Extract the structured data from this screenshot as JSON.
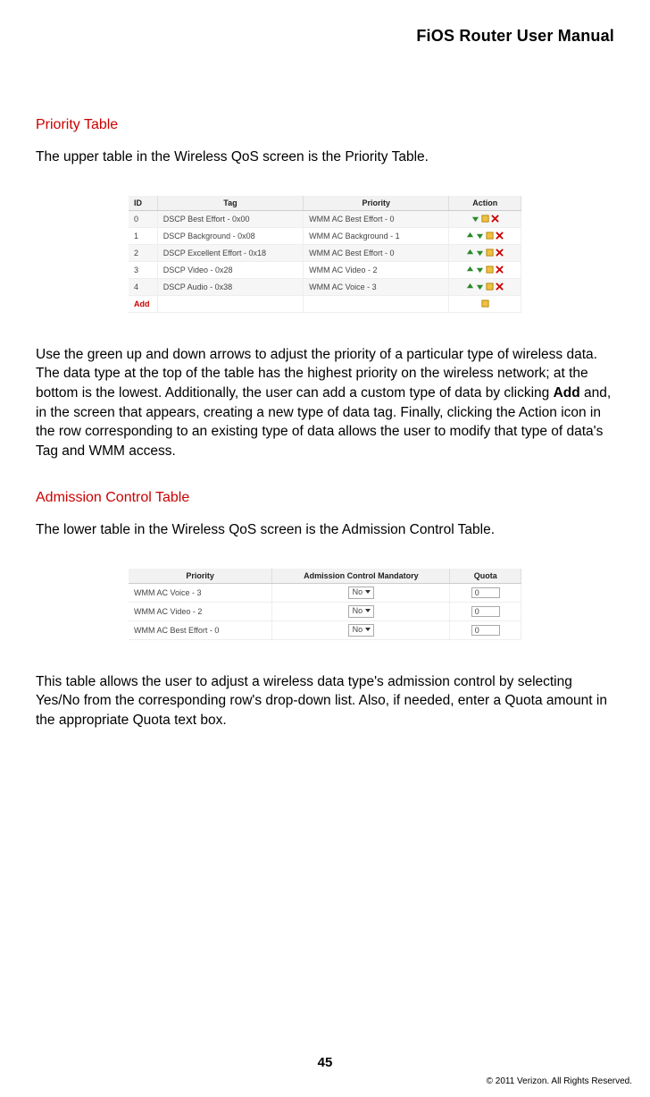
{
  "header": {
    "title": "FiOS Router User Manual"
  },
  "section1": {
    "heading": "Priority Table",
    "intro": "The upper table in the Wireless QoS screen is the Priority Table."
  },
  "priority_table": {
    "headers": {
      "id": "ID",
      "tag": "Tag",
      "priority": "Priority",
      "action": "Action"
    },
    "rows": [
      {
        "id": "0",
        "tag": "DSCP Best Effort - 0x00",
        "priority": "WMM AC Best Effort - 0",
        "first": true
      },
      {
        "id": "1",
        "tag": "DSCP Background - 0x08",
        "priority": "WMM AC Background - 1",
        "first": false
      },
      {
        "id": "2",
        "tag": "DSCP Excellent Effort - 0x18",
        "priority": "WMM AC Best Effort - 0",
        "first": false
      },
      {
        "id": "3",
        "tag": "DSCP Video - 0x28",
        "priority": "WMM AC Video - 2",
        "first": false
      },
      {
        "id": "4",
        "tag": "DSCP Audio - 0x38",
        "priority": "WMM AC Voice - 3",
        "first": false
      }
    ],
    "add_label": "Add"
  },
  "section1_body": "Use the green up and down arrows to adjust the priority of a particular type of wireless data. The data type at the top of the table has the highest priority on the wireless network; at the bottom is the lowest. Additionally, the user can add a custom type of data by clicking ",
  "section1_body_bold": "Add",
  "section1_body_tail": " and, in the screen that appears, creating a new type of data tag. Finally, clicking the Action icon in the row corresponding to an existing type of data allows the user to modify that type of data's Tag and WMM access.",
  "section2": {
    "heading": "Admission Control Table",
    "intro": "The lower table in the Wireless QoS screen is the Admission Control Table."
  },
  "admission_table": {
    "headers": {
      "priority": "Priority",
      "mandatory": "Admission Control Mandatory",
      "quota": "Quota"
    },
    "rows": [
      {
        "priority": "WMM AC Voice - 3",
        "select": "No",
        "quota": "0"
      },
      {
        "priority": "WMM AC Video - 2",
        "select": "No",
        "quota": "0"
      },
      {
        "priority": "WMM AC Best Effort - 0",
        "select": "No",
        "quota": "0"
      }
    ]
  },
  "section2_body": "This table allows the user to adjust a wireless data type's admission control by selecting Yes/No from the corresponding row's drop-down list. Also, if needed, enter a Quota amount in the appropriate Quota text box.",
  "footer": {
    "page": "45",
    "copyright": "© 2011 Verizon. All Rights Reserved."
  }
}
